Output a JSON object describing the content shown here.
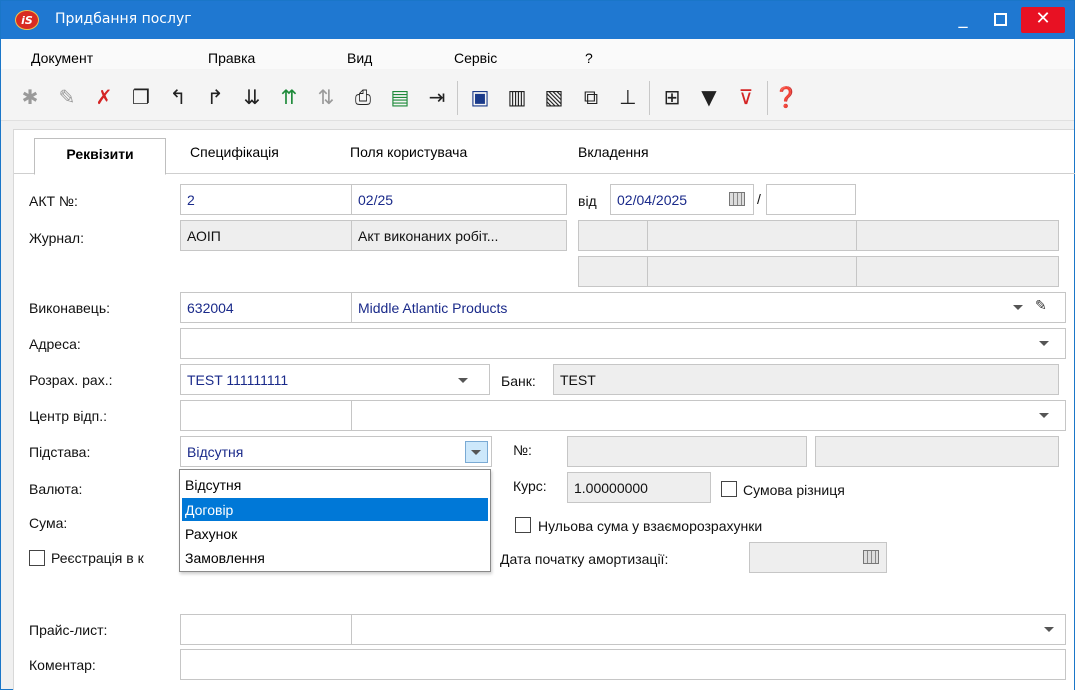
{
  "window": {
    "title": "Придбання послуг",
    "logo_text": "iS",
    "min": "_",
    "close": "✕"
  },
  "menu": [
    "Документ",
    "Правка",
    "Вид",
    "Сервіс",
    "?"
  ],
  "tabs": [
    "Реквізити",
    "Специфікація",
    "Поля користувача",
    "Вкладення"
  ],
  "form": {
    "act_label": "АКТ №:",
    "act_no": "2",
    "act_series": "02/25",
    "from_label": "від",
    "date": "02/04/2025",
    "slash": "/",
    "journal_label": "Журнал:",
    "journal_code": "АОІП",
    "journal_name": "Акт виконаних робіт...",
    "executor_label": "Виконавець:",
    "executor_code": "632004",
    "executor_name": "Middle Atlantic Products",
    "address_label": "Адреса:",
    "account_label": "Розрах. рах.:",
    "account_value": "TEST 111111111",
    "bank_label": "Банк:",
    "bank_value": "TEST",
    "center_label": "Центр відп.:",
    "basis_label": "Підстава:",
    "basis_value": "Відсутня",
    "no_label": "№:",
    "currency_label": "Валюта:",
    "rate_label": "Курс:",
    "rate_value": "1.00000000",
    "sum_diff_label": "Сумова різниця",
    "sum_label": "Сума:",
    "zero_sum_label": "Нульова сума у взаєморозрахунки",
    "registration_label": "Реєстрація в к",
    "amort_label": "Дата початку амортизації:",
    "price_list_label": "Прайс-лист:",
    "comment_label": "Коментар:"
  },
  "dropdown": {
    "options": [
      "Відсутня",
      "Договір",
      "Рахунок",
      "Замовлення"
    ],
    "selected_index": 1
  },
  "colors": {
    "titlebar": "#1f78d1",
    "selection": "#0078d7",
    "close": "#e81123"
  }
}
